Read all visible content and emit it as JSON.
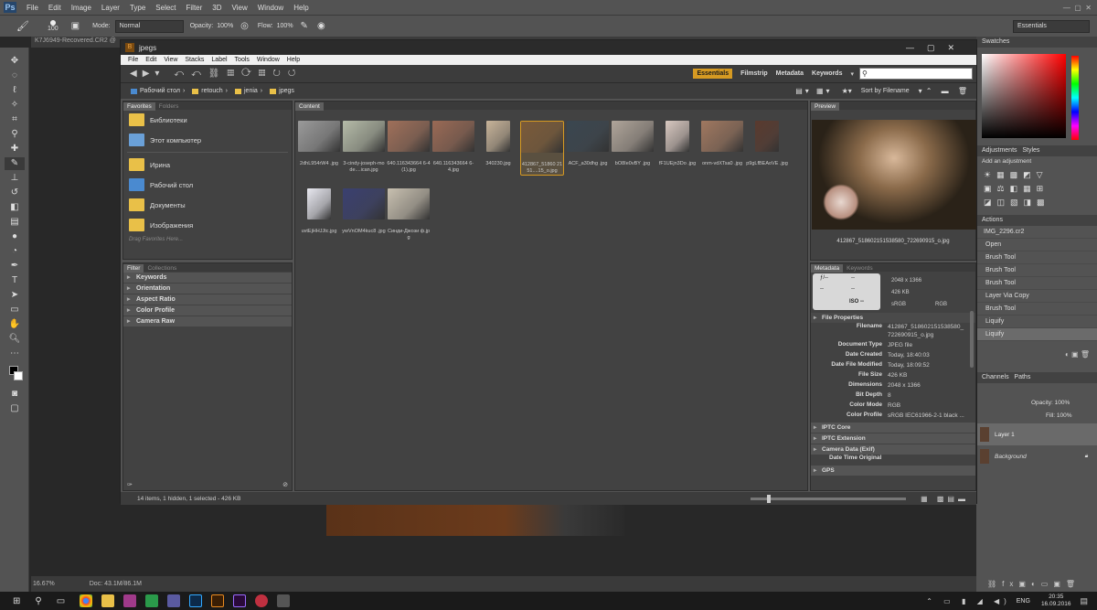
{
  "ps": {
    "logo": "Ps",
    "menu": [
      "File",
      "Edit",
      "Image",
      "Layer",
      "Type",
      "Select",
      "Filter",
      "3D",
      "View",
      "Window",
      "Help"
    ],
    "options": {
      "brush_size": "100",
      "mode_label": "Mode:",
      "mode_value": "Normal",
      "opacity_label": "Opacity:",
      "opacity_value": "100%",
      "flow_label": "Flow:",
      "flow_value": "100%"
    },
    "workspace": "Essentials",
    "doc_tab": "K7J6949-Recovered.CR2 @ ",
    "status": {
      "zoom": "16.67%",
      "doc": "Doc: 43.1M/86.1M"
    },
    "right_panels": {
      "swatches": "Swatches",
      "adjustments_tabs": [
        "Adjustments",
        "Styles"
      ],
      "add_adjustment": "Add an adjustment",
      "actions_tab": "Actions",
      "history_doc": "IMG_2296.cr2",
      "history": [
        "Open",
        "Brush Tool",
        "Brush Tool",
        "Brush Tool",
        "Layer Via Copy",
        "Brush Tool",
        "Liquify",
        "Liquify"
      ],
      "layers_tabs": [
        "Channels",
        "Paths"
      ],
      "opacity_label": "Opacity:",
      "opacity_value": "100%",
      "fill_label": "Fill:",
      "fill_value": "100%",
      "layers": [
        "Layer 1",
        "Background"
      ]
    }
  },
  "bridge": {
    "title": "jpegs",
    "menu": [
      "File",
      "Edit",
      "View",
      "Stacks",
      "Label",
      "Tools",
      "Window",
      "Help"
    ],
    "workspaces": [
      "Essentials",
      "Filmstrip",
      "Metadata",
      "Keywords"
    ],
    "search_placeholder": "",
    "path": [
      "Рабочий стол",
      "retouch",
      "jenia",
      "jpegs"
    ],
    "sort_label": "Sort by Filename",
    "favorites_tabs": [
      "Favorites",
      "Folders"
    ],
    "favorites": [
      "Библиотеки",
      "Этот компьютер",
      "Ирина",
      "Рабочий стол",
      "Документы",
      "Изображения"
    ],
    "drag_hint": "Drag Favorites Here...",
    "filter_tabs": [
      "Filter",
      "Collections"
    ],
    "filters": [
      "Keywords",
      "Orientation",
      "Aspect Ratio",
      "Color Profile",
      "Camera Raw"
    ],
    "content_tab": "Content",
    "thumbnails": [
      {
        "name": "2dhL954rW4 .jpg",
        "color": "#9a9a9a"
      },
      {
        "name": "3-cindy-joseph-mode....ican.jpg",
        "color": "#b5bba8"
      },
      {
        "name": "640.116343664 6-4 (1).jpg",
        "color": "#a0705a"
      },
      {
        "name": "640.116343664 6-4.jpg",
        "color": "#9a6a55"
      },
      {
        "name": "340230.jpg",
        "color": "#c8b49a"
      },
      {
        "name": "412867_51860 2151....15_o.jpg",
        "color": "#7a5a3a"
      },
      {
        "name": "ACF_a30dhg .jpg",
        "color": "#3a4650"
      },
      {
        "name": "bO8Ie0vBY .jpg",
        "color": "#b0a59a"
      },
      {
        "name": "fF1UEjn3Do .jpg",
        "color": "#d8c8c0"
      },
      {
        "name": "onm-vdXTsa0 .jpg",
        "color": "#a07860"
      },
      {
        "name": "p9gLfBEAoVE .jpg",
        "color": "#5a3a2e"
      },
      {
        "name": "uvtEjHHJJtc.jpg",
        "color": "#e8e8f0"
      },
      {
        "name": "ywVnOM4kuc8 .jpg",
        "color": "#3a4070"
      },
      {
        "name": "Синди-Джози ф.jpg",
        "color": "#c8c0b0"
      }
    ],
    "preview_tab": "Preview",
    "preview_caption": "412867_518602151538580_722690915_o.jpg",
    "metadata_tabs": [
      "Metadata",
      "Keywords"
    ],
    "camera_box": {
      "f": "ƒ/--",
      "dash1": "--",
      "dash2": "--",
      "dash3": "--",
      "iso": "ISO --",
      "dims": "2048 x 1366",
      "size": "426 KB",
      "cs1": "sRGB",
      "cs2": "RGB"
    },
    "file_properties_title": "File Properties",
    "file_properties": [
      {
        "k": "Filename",
        "v": "412867_518602151538580_722690915_o.jpg"
      },
      {
        "k": "Document Type",
        "v": "JPEG file"
      },
      {
        "k": "Date Created",
        "v": "Today, 18:40:03"
      },
      {
        "k": "Date File Modified",
        "v": "Today, 18:09:52"
      },
      {
        "k": "File Size",
        "v": "426 KB"
      },
      {
        "k": "Dimensions",
        "v": "2048 x 1366"
      },
      {
        "k": "Bit Depth",
        "v": "8"
      },
      {
        "k": "Color Mode",
        "v": "RGB"
      },
      {
        "k": "Color Profile",
        "v": "sRGB IEC61966-2-1 black ..."
      }
    ],
    "sections": [
      "IPTC Core",
      "IPTC Extension",
      "Camera Data (Exif)"
    ],
    "date_time_original": "Date Time Original",
    "gps": "GPS",
    "status": "14 items, 1 hidden, 1 selected - 426 KB"
  },
  "taskbar": {
    "lang": "ENG",
    "time": "20:35",
    "date": "16.09.2016"
  },
  "colors": {
    "accent": "#d69a22",
    "bridge_bg": "#535353",
    "panel": "#424242"
  }
}
